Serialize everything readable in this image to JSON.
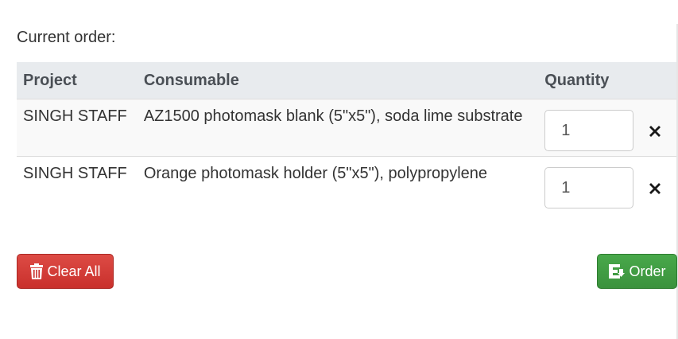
{
  "heading": "Current order:",
  "table": {
    "columns": [
      "Project",
      "Consumable",
      "Quantity"
    ],
    "rows": [
      {
        "project": "SINGH STAFF",
        "consumable": "AZ1500 photomask blank (5\"x5\"), soda lime substrate",
        "quantity": "1"
      },
      {
        "project": "SINGH STAFF",
        "consumable": "Orange photomask holder (5\"x5\"), polypropylene",
        "quantity": "1"
      }
    ]
  },
  "buttons": {
    "clear_all": "Clear All",
    "order": "Order"
  },
  "icons": {
    "remove": "close-icon",
    "clear": "trash-icon",
    "order": "cart-icon"
  },
  "colors": {
    "danger": "#d9534f",
    "success": "#449d44",
    "header_bg": "#e8ebee"
  }
}
